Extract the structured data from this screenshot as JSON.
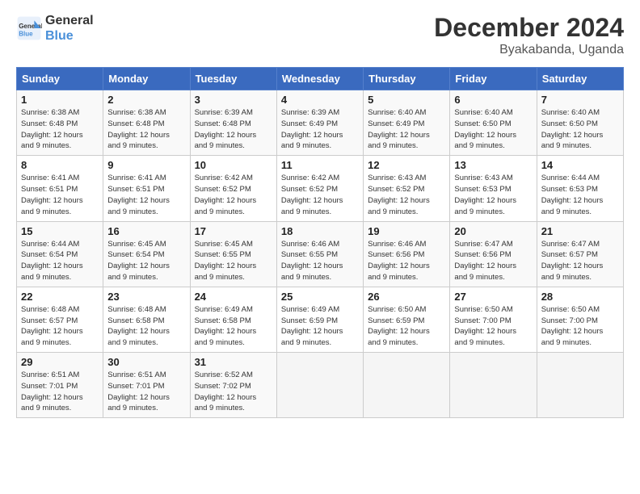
{
  "header": {
    "logo_line1": "General",
    "logo_line2": "Blue",
    "month_title": "December 2024",
    "location": "Byakabanda, Uganda"
  },
  "days_of_week": [
    "Sunday",
    "Monday",
    "Tuesday",
    "Wednesday",
    "Thursday",
    "Friday",
    "Saturday"
  ],
  "weeks": [
    [
      {
        "day": "1",
        "sunrise": "6:38 AM",
        "sunset": "6:48 PM",
        "daylight": "12 hours and 9 minutes."
      },
      {
        "day": "2",
        "sunrise": "6:38 AM",
        "sunset": "6:48 PM",
        "daylight": "12 hours and 9 minutes."
      },
      {
        "day": "3",
        "sunrise": "6:39 AM",
        "sunset": "6:48 PM",
        "daylight": "12 hours and 9 minutes."
      },
      {
        "day": "4",
        "sunrise": "6:39 AM",
        "sunset": "6:49 PM",
        "daylight": "12 hours and 9 minutes."
      },
      {
        "day": "5",
        "sunrise": "6:40 AM",
        "sunset": "6:49 PM",
        "daylight": "12 hours and 9 minutes."
      },
      {
        "day": "6",
        "sunrise": "6:40 AM",
        "sunset": "6:50 PM",
        "daylight": "12 hours and 9 minutes."
      },
      {
        "day": "7",
        "sunrise": "6:40 AM",
        "sunset": "6:50 PM",
        "daylight": "12 hours and 9 minutes."
      }
    ],
    [
      {
        "day": "8",
        "sunrise": "6:41 AM",
        "sunset": "6:51 PM",
        "daylight": "12 hours and 9 minutes."
      },
      {
        "day": "9",
        "sunrise": "6:41 AM",
        "sunset": "6:51 PM",
        "daylight": "12 hours and 9 minutes."
      },
      {
        "day": "10",
        "sunrise": "6:42 AM",
        "sunset": "6:52 PM",
        "daylight": "12 hours and 9 minutes."
      },
      {
        "day": "11",
        "sunrise": "6:42 AM",
        "sunset": "6:52 PM",
        "daylight": "12 hours and 9 minutes."
      },
      {
        "day": "12",
        "sunrise": "6:43 AM",
        "sunset": "6:52 PM",
        "daylight": "12 hours and 9 minutes."
      },
      {
        "day": "13",
        "sunrise": "6:43 AM",
        "sunset": "6:53 PM",
        "daylight": "12 hours and 9 minutes."
      },
      {
        "day": "14",
        "sunrise": "6:44 AM",
        "sunset": "6:53 PM",
        "daylight": "12 hours and 9 minutes."
      }
    ],
    [
      {
        "day": "15",
        "sunrise": "6:44 AM",
        "sunset": "6:54 PM",
        "daylight": "12 hours and 9 minutes."
      },
      {
        "day": "16",
        "sunrise": "6:45 AM",
        "sunset": "6:54 PM",
        "daylight": "12 hours and 9 minutes."
      },
      {
        "day": "17",
        "sunrise": "6:45 AM",
        "sunset": "6:55 PM",
        "daylight": "12 hours and 9 minutes."
      },
      {
        "day": "18",
        "sunrise": "6:46 AM",
        "sunset": "6:55 PM",
        "daylight": "12 hours and 9 minutes."
      },
      {
        "day": "19",
        "sunrise": "6:46 AM",
        "sunset": "6:56 PM",
        "daylight": "12 hours and 9 minutes."
      },
      {
        "day": "20",
        "sunrise": "6:47 AM",
        "sunset": "6:56 PM",
        "daylight": "12 hours and 9 minutes."
      },
      {
        "day": "21",
        "sunrise": "6:47 AM",
        "sunset": "6:57 PM",
        "daylight": "12 hours and 9 minutes."
      }
    ],
    [
      {
        "day": "22",
        "sunrise": "6:48 AM",
        "sunset": "6:57 PM",
        "daylight": "12 hours and 9 minutes."
      },
      {
        "day": "23",
        "sunrise": "6:48 AM",
        "sunset": "6:58 PM",
        "daylight": "12 hours and 9 minutes."
      },
      {
        "day": "24",
        "sunrise": "6:49 AM",
        "sunset": "6:58 PM",
        "daylight": "12 hours and 9 minutes."
      },
      {
        "day": "25",
        "sunrise": "6:49 AM",
        "sunset": "6:59 PM",
        "daylight": "12 hours and 9 minutes."
      },
      {
        "day": "26",
        "sunrise": "6:50 AM",
        "sunset": "6:59 PM",
        "daylight": "12 hours and 9 minutes."
      },
      {
        "day": "27",
        "sunrise": "6:50 AM",
        "sunset": "7:00 PM",
        "daylight": "12 hours and 9 minutes."
      },
      {
        "day": "28",
        "sunrise": "6:50 AM",
        "sunset": "7:00 PM",
        "daylight": "12 hours and 9 minutes."
      }
    ],
    [
      {
        "day": "29",
        "sunrise": "6:51 AM",
        "sunset": "7:01 PM",
        "daylight": "12 hours and 9 minutes."
      },
      {
        "day": "30",
        "sunrise": "6:51 AM",
        "sunset": "7:01 PM",
        "daylight": "12 hours and 9 minutes."
      },
      {
        "day": "31",
        "sunrise": "6:52 AM",
        "sunset": "7:02 PM",
        "daylight": "12 hours and 9 minutes."
      },
      null,
      null,
      null,
      null
    ]
  ]
}
